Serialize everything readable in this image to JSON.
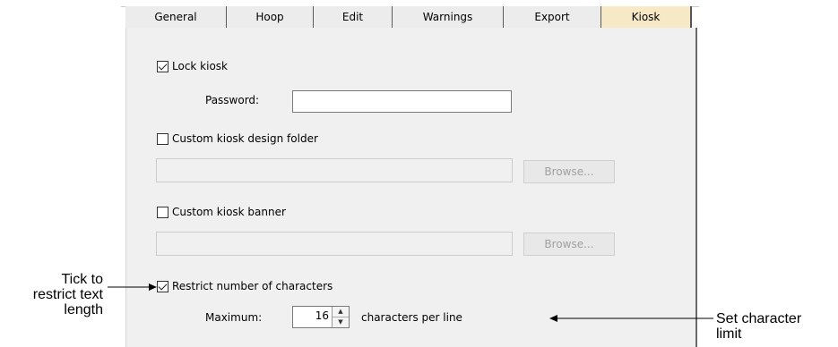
{
  "tabs": [
    {
      "label": "General"
    },
    {
      "label": "Hoop"
    },
    {
      "label": "Edit"
    },
    {
      "label": "Warnings"
    },
    {
      "label": "Export"
    },
    {
      "label": "Kiosk",
      "active": true
    }
  ],
  "kiosk": {
    "lock_kiosk": {
      "label": "Lock kiosk",
      "checked": true
    },
    "password": {
      "label": "Password:",
      "value": ""
    },
    "custom_design_folder": {
      "label": "Custom kiosk design folder",
      "checked": false,
      "path": "",
      "browse_label": "Browse..."
    },
    "custom_banner": {
      "label": "Custom kiosk banner",
      "checked": false,
      "path": "",
      "browse_label": "Browse..."
    },
    "restrict_characters": {
      "label": "Restrict number of characters",
      "checked": true
    },
    "maximum": {
      "label": "Maximum:",
      "value": "16",
      "suffix": "characters per line"
    }
  },
  "annotations": {
    "left": {
      "line1": "Tick to",
      "line2": "restrict text",
      "line3": "length"
    },
    "right": {
      "line1": "Set character",
      "line2": "limit"
    }
  }
}
